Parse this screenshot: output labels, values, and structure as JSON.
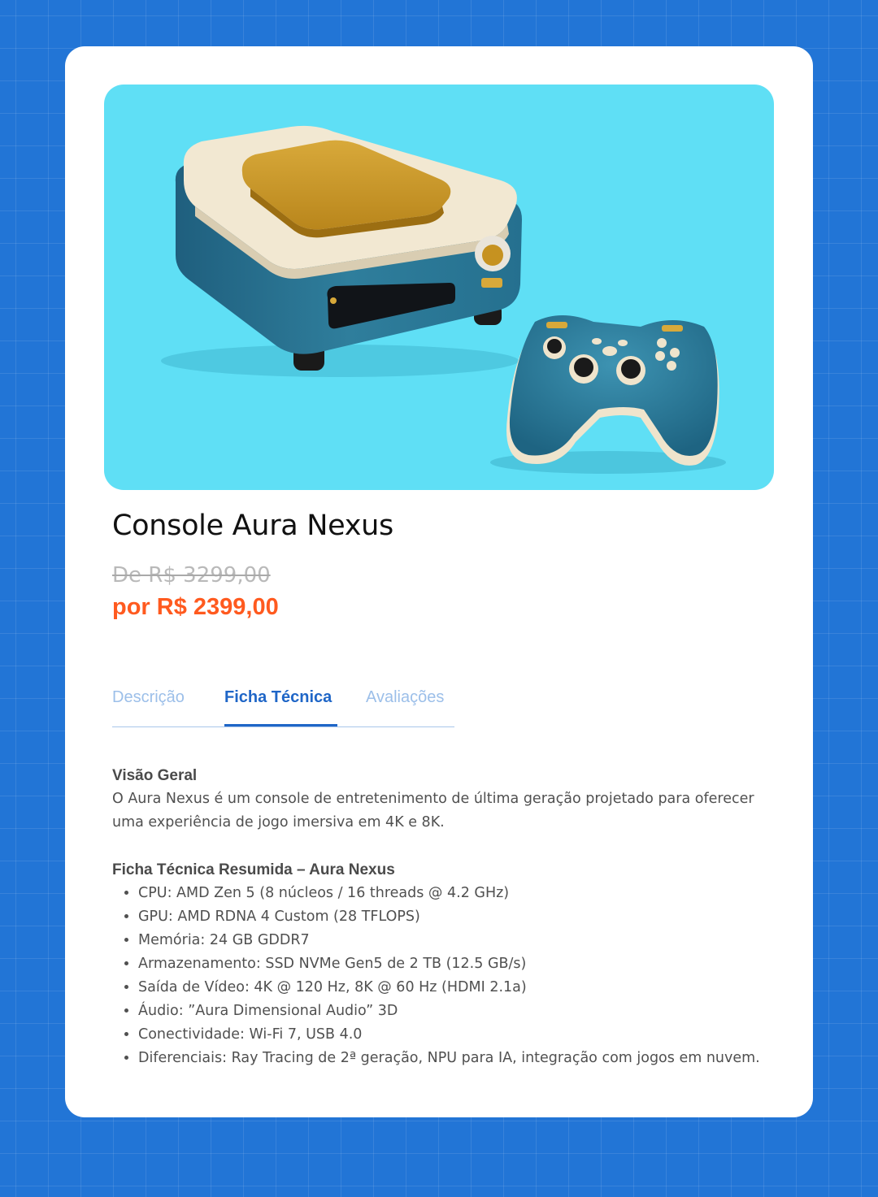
{
  "product": {
    "title": "Console Aura Nexus",
    "old_price": "De R$ 3299,00",
    "new_price": "por R$ 2399,00",
    "image_icons": [
      "game-console-illustration",
      "gamepad-illustration"
    ]
  },
  "tabs": [
    {
      "label": "Descrição",
      "active": false
    },
    {
      "label": "Ficha Técnica",
      "active": true
    },
    {
      "label": "Avaliações",
      "active": false
    }
  ],
  "content": {
    "overview_heading": "Visão Geral",
    "overview_text": "O Aura Nexus é um console de entretenimento de última geração projetado para oferecer uma experiência de jogo imersiva em 4K e 8K.",
    "specs_heading": "Ficha Técnica Resumida – Aura Nexus",
    "specs": [
      "CPU: AMD Zen 5 (8 núcleos / 16 threads @ 4.2 GHz)",
      "GPU: AMD RDNA 4 Custom (28 TFLOPS)",
      "Memória: 24 GB GDDR7",
      "Armazenamento: SSD NVMe Gen5 de 2 TB (12.5 GB/s)",
      "Saída de Vídeo: 4K @ 120 Hz, 8K @ 60 Hz (HDMI 2.1a)",
      "Áudio: ”Aura Dimensional Audio” 3D",
      "Conectividade: Wi-Fi 7, USB 4.0",
      "Diferenciais: Ray Tracing de 2ª geração, NPU para IA, integração com jogos em nuvem."
    ]
  },
  "colors": {
    "page_background": "#2275d6",
    "hero_background": "#5fdff5",
    "accent_price": "#ff5a1f",
    "active_tab": "#1f66c7",
    "inactive_tab": "#9cbfe9"
  }
}
